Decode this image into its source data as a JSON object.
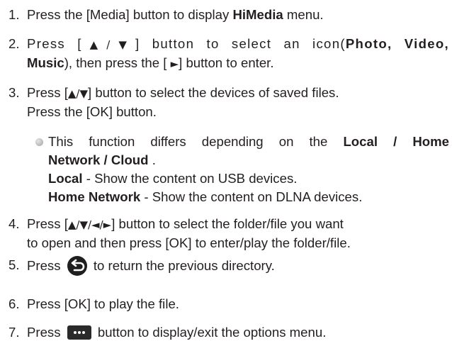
{
  "steps": [
    {
      "num": "1.",
      "a": "Press the [Media] button to display ",
      "b": "HiMedia",
      "c": " menu."
    },
    {
      "num": "2.",
      "l1a": "Press [",
      "l1g": "▲/▼",
      "l1b": "] button to select an icon(",
      "l1c": "Photo, Video,",
      "l2a": "Music",
      "l2b": "), then press the [ ",
      "l2g": "►",
      "l2c": "] button to enter."
    },
    {
      "num": "3.",
      "l1a": "Press [",
      "l1g": "▲/▼",
      "l1b": "] button to select the devices of saved files.",
      "l2": "Press the [OK] button."
    },
    {
      "num": "4.",
      "l1a": "Press [",
      "l1g": "▲/▼/◄/►",
      "l1b": "] button to select the folder/file you want",
      "l2": "to open and then press [OK] to enter/play the folder/file."
    },
    {
      "num": "5.",
      "a": "Press ",
      "icon": "return-icon",
      "b": " to return the previous directory."
    },
    {
      "num": "6.",
      "a": "Press [OK] to play the file."
    },
    {
      "num": "7.",
      "a": "Press ",
      "icon": "more-options-icon",
      "b": " button to display/exit the options menu."
    }
  ],
  "note": {
    "l1a": "This function differs depending on the ",
    "l1b": "Local / Home",
    "l2a": "Network / Cloud",
    "l2b": " .",
    "l3a": "Local",
    "l3b": " - Show the content on USB devices.",
    "l4a": "Home Network",
    "l4b": " - Show the content on DLNA devices."
  }
}
